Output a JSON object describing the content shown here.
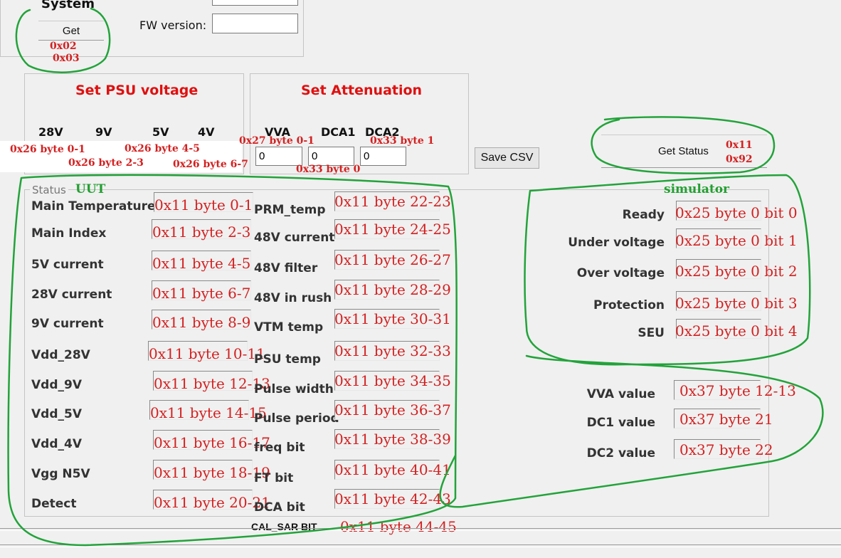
{
  "system": {
    "title": "System",
    "fw_label": "FW version:",
    "get_button": "Get",
    "ann_1": "0x02",
    "ann_2": "0x03"
  },
  "psu": {
    "title": "Set PSU voltage",
    "labels": [
      "28V",
      "9V",
      "5V",
      "4V"
    ],
    "ann": [
      "0x26 byte 0-1",
      "0x26 byte 4-5",
      "0x26 byte 2-3",
      "0x26 byte 6-7"
    ]
  },
  "atten": {
    "title": "Set Attenuation",
    "labels": [
      "VVA",
      "DCA1",
      "DCA2"
    ],
    "values": [
      "0",
      "0",
      "0"
    ],
    "ann_vva": "0x27 byte 0-1",
    "ann_dca2": "0x33 byte 1",
    "ann_dca1": "0x33 byte 0"
  },
  "save_csv": "Save CSV",
  "get_status": {
    "label": "Get Status",
    "ann_1": "0x11",
    "ann_2": "0x92"
  },
  "status": {
    "title": "Status",
    "uut_note": "UUT",
    "simulator_note": "simulator",
    "left": [
      {
        "label": "Main Temperature",
        "ann": "0x11 byte 0-1"
      },
      {
        "label": "Main Index",
        "ann": "0x11 byte 2-3"
      },
      {
        "label": "5V current",
        "ann": "0x11 byte 4-5"
      },
      {
        "label": "28V current",
        "ann": "0x11 byte 6-7"
      },
      {
        "label": "9V current",
        "ann": "0x11 byte 8-9"
      },
      {
        "label": "Vdd_28V",
        "ann": "0x11 byte 10-11"
      },
      {
        "label": "Vdd_9V",
        "ann": "0x11 byte 12-13"
      },
      {
        "label": "Vdd_5V",
        "ann": "0x11 byte 14-15"
      },
      {
        "label": "Vdd_4V",
        "ann": "0x11 byte 16-17"
      },
      {
        "label": "Vgg N5V",
        "ann": "0x11 byte 18-19"
      },
      {
        "label": "Detect",
        "ann": "0x11 byte 20-21"
      }
    ],
    "mid": [
      {
        "label": "PRM_temp",
        "ann": "0x11 byte 22-23"
      },
      {
        "label": "48V current",
        "ann": "0x11 byte 24-25"
      },
      {
        "label": "48V filter",
        "ann": "0x11 byte 26-27"
      },
      {
        "label": "48V in rush",
        "ann": "0x11 byte 28-29"
      },
      {
        "label": "VTM temp",
        "ann": "0x11 byte 30-31"
      },
      {
        "label": "PSU temp",
        "ann": "0x11 byte 32-33"
      },
      {
        "label": "Pulse width",
        "ann": "0x11 byte 34-35"
      },
      {
        "label": "Pulse period",
        "ann": "0x11 byte 36-37"
      },
      {
        "label": "freq bit",
        "ann": "0x11 byte 38-39"
      },
      {
        "label": "FT bit",
        "ann": "0x11 byte 40-41"
      },
      {
        "label": "DCA bit",
        "ann": "0x11 byte 42-43"
      }
    ],
    "cal_sar": {
      "label": "CAL_SAR BIT",
      "ann": "0x11 byte 44-45"
    },
    "right": [
      {
        "label": "Ready",
        "ann": "0x25 byte 0 bit 0"
      },
      {
        "label": "Under voltage",
        "ann": "0x25 byte 0 bit 1"
      },
      {
        "label": "Over voltage",
        "ann": "0x25 byte 0 bit 2"
      },
      {
        "label": "Protection",
        "ann": "0x25 byte 0 bit 3"
      },
      {
        "label": "SEU",
        "ann": "0x25 byte 0 bit 4"
      }
    ],
    "values": [
      {
        "label": "VVA value",
        "ann": "0x37 byte 12-13"
      },
      {
        "label": "DC1 value",
        "ann": "0x37 byte 21"
      },
      {
        "label": "DC2 value",
        "ann": "0x37 byte 22"
      }
    ]
  }
}
